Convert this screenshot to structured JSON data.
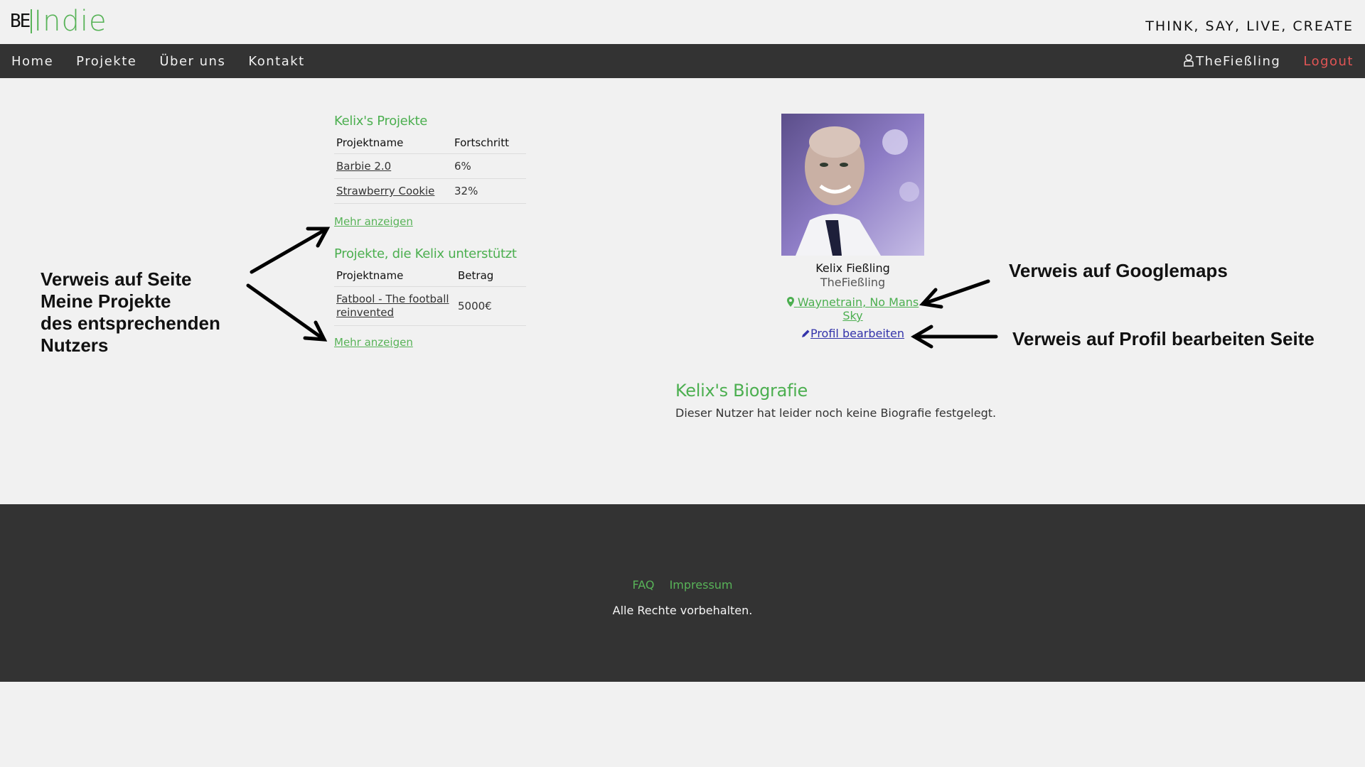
{
  "header": {
    "logo_mark": "BE",
    "logo_text": "Indie",
    "tagline": "THINK, SAY, LIVE, CREATE"
  },
  "nav": {
    "items": [
      "Home",
      "Projekte",
      "Über uns",
      "Kontakt"
    ],
    "username": "TheFießling",
    "logout": "Logout"
  },
  "projects": {
    "title": "Kelix's Projekte",
    "col_name": "Projektname",
    "col_progress": "Fortschritt",
    "rows": [
      {
        "name": "Barbie 2.0",
        "progress": "6%"
      },
      {
        "name": "Strawberry Cookie",
        "progress": "32%"
      }
    ],
    "more": "Mehr anzeigen"
  },
  "supported": {
    "title": "Projekte, die Kelix unterstützt",
    "col_name": "Projektname",
    "col_amount": "Betrag",
    "rows": [
      {
        "name": "Fatbool - The football reinvented",
        "amount": "5000€"
      }
    ],
    "more": "Mehr anzeigen"
  },
  "annotations": {
    "left_line1": "Verweis auf Seite",
    "left_line2": "Meine Projekte",
    "left_line3": "des entsprechenden",
    "left_line4": "Nutzers",
    "maps": "Verweis auf Googlemaps",
    "edit": "Verweis auf Profil bearbeiten Seite"
  },
  "profile": {
    "full_name": "Kelix Fießling",
    "username": "TheFießling",
    "location_line1": "Waynetrain, No Mans",
    "location_line2": "Sky",
    "edit_label": "Profil bearbeiten"
  },
  "bio": {
    "title": "Kelix's Biografie",
    "text": "Dieser Nutzer hat leider noch keine Biografie festgelegt."
  },
  "footer": {
    "links": [
      "FAQ",
      "Impressum"
    ],
    "copyright": "Alle Rechte vorbehalten."
  },
  "colors": {
    "accent_green": "#58b358",
    "nav_bg": "#333333",
    "logout_red": "#e25555",
    "edit_link_blue": "#3333aa"
  }
}
